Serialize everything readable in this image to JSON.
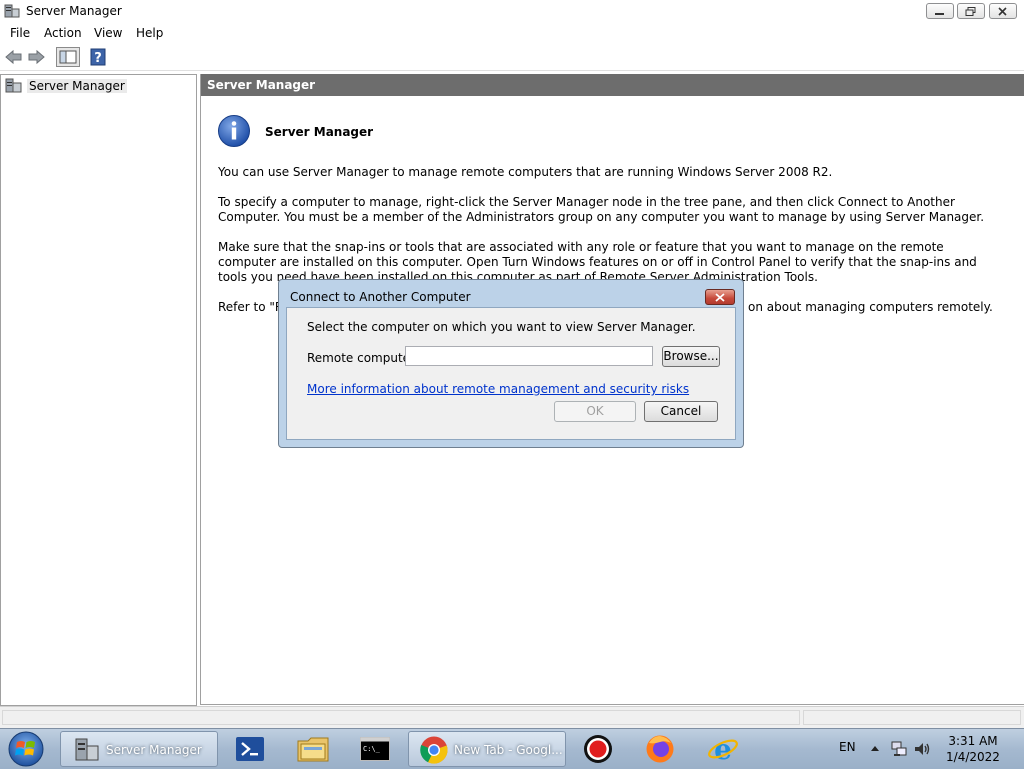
{
  "window": {
    "title": "Server Manager",
    "icons": {
      "app": "server-manager-icon",
      "minimize": "minimize-icon",
      "maximize": "restore-icon",
      "close": "close-icon"
    }
  },
  "menu": {
    "file": "File",
    "action": "Action",
    "view": "View",
    "help": "Help"
  },
  "toolbar": {
    "icons": [
      "back-arrow-icon",
      "forward-arrow-icon",
      "show-hide-tree-icon",
      "help-icon"
    ]
  },
  "tree": {
    "root": "Server Manager"
  },
  "main": {
    "header": "Server Manager",
    "heading": "Server Manager",
    "p1": "You can use Server Manager to manage remote computers that are running Windows Server 2008 R2.",
    "p2": "To specify a computer to manage, right-click the Server Manager node in the tree pane, and then click Connect to Another Computer.  You must be a member of the Administrators group on any computer you want to manage by using Server Manager.",
    "p3": "Make sure that the snap-ins or tools that are associated with any role or feature that you want to manage on the remote computer are installed on this computer. Open Turn Windows features on or off in Control Panel to verify that the snap-ins and tools you need have been installed on this computer as part of Remote Server Administration Tools.",
    "p4_left": "Refer to \"Re",
    "p4_right": "on about managing computers remotely."
  },
  "dialog": {
    "title": "Connect to Another Computer",
    "prompt": "Select the computer on which you want to view Server Manager.",
    "remote_label": "Remote computer:",
    "remote_value": "",
    "browse": "Browse...",
    "link": "More information about remote management and security risks",
    "ok": "OK",
    "cancel": "Cancel"
  },
  "taskbar": {
    "server_manager": "Server Manager",
    "chrome": "New Tab - Googl...",
    "lang": "EN",
    "time": "3:31 AM",
    "date": "1/4/2022"
  },
  "colors": {
    "header": "#6d6d6d",
    "dialog_frame": "#bcd2e8",
    "link": "#0033cc",
    "taskbar": "#a5b9d0"
  }
}
